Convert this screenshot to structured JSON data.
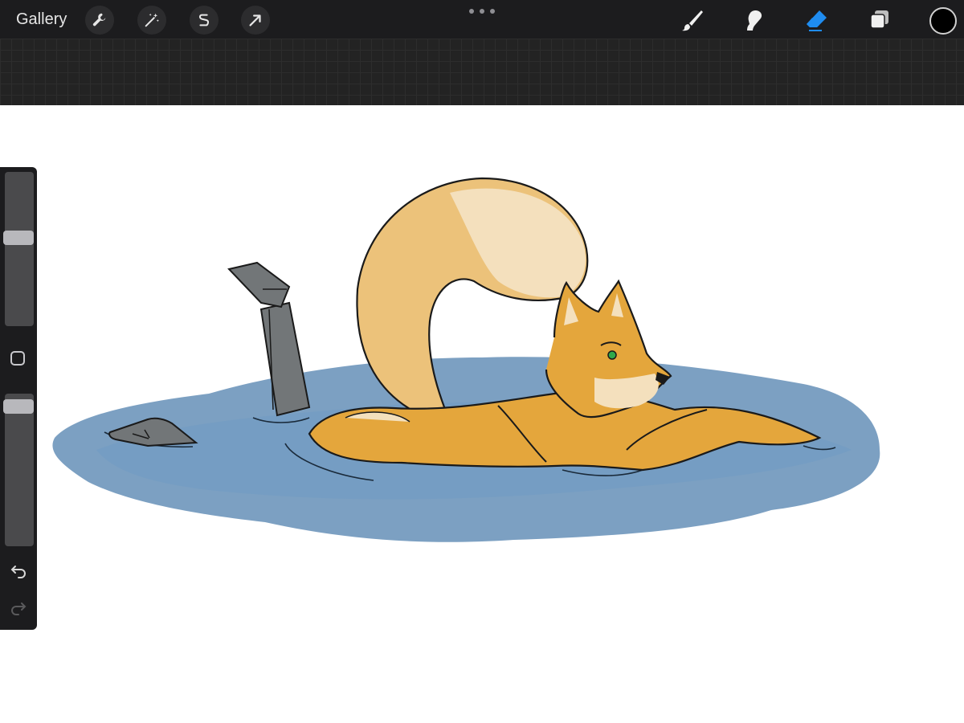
{
  "toolbar": {
    "gallery_label": "Gallery",
    "left_tools": [
      "wrench-icon",
      "magic-wand-icon",
      "selection-s-icon",
      "arrow-cursor-icon"
    ],
    "right_tools": [
      "brush-icon",
      "smudge-icon",
      "eraser-icon",
      "layers-icon"
    ],
    "active_tool": "eraser-icon",
    "active_color": "#000000",
    "accent": "#1f8cf0"
  },
  "sidebar": {
    "brush_size_level": 0.58,
    "opacity_level": 0.96,
    "icons": [
      "modifier-square-icon",
      "undo-icon",
      "redo-icon"
    ]
  },
  "colors": {
    "fur": "#e4a63c",
    "fur_light": "#f4e0bd",
    "water": "#5f8bb5",
    "boot": "#727678"
  }
}
